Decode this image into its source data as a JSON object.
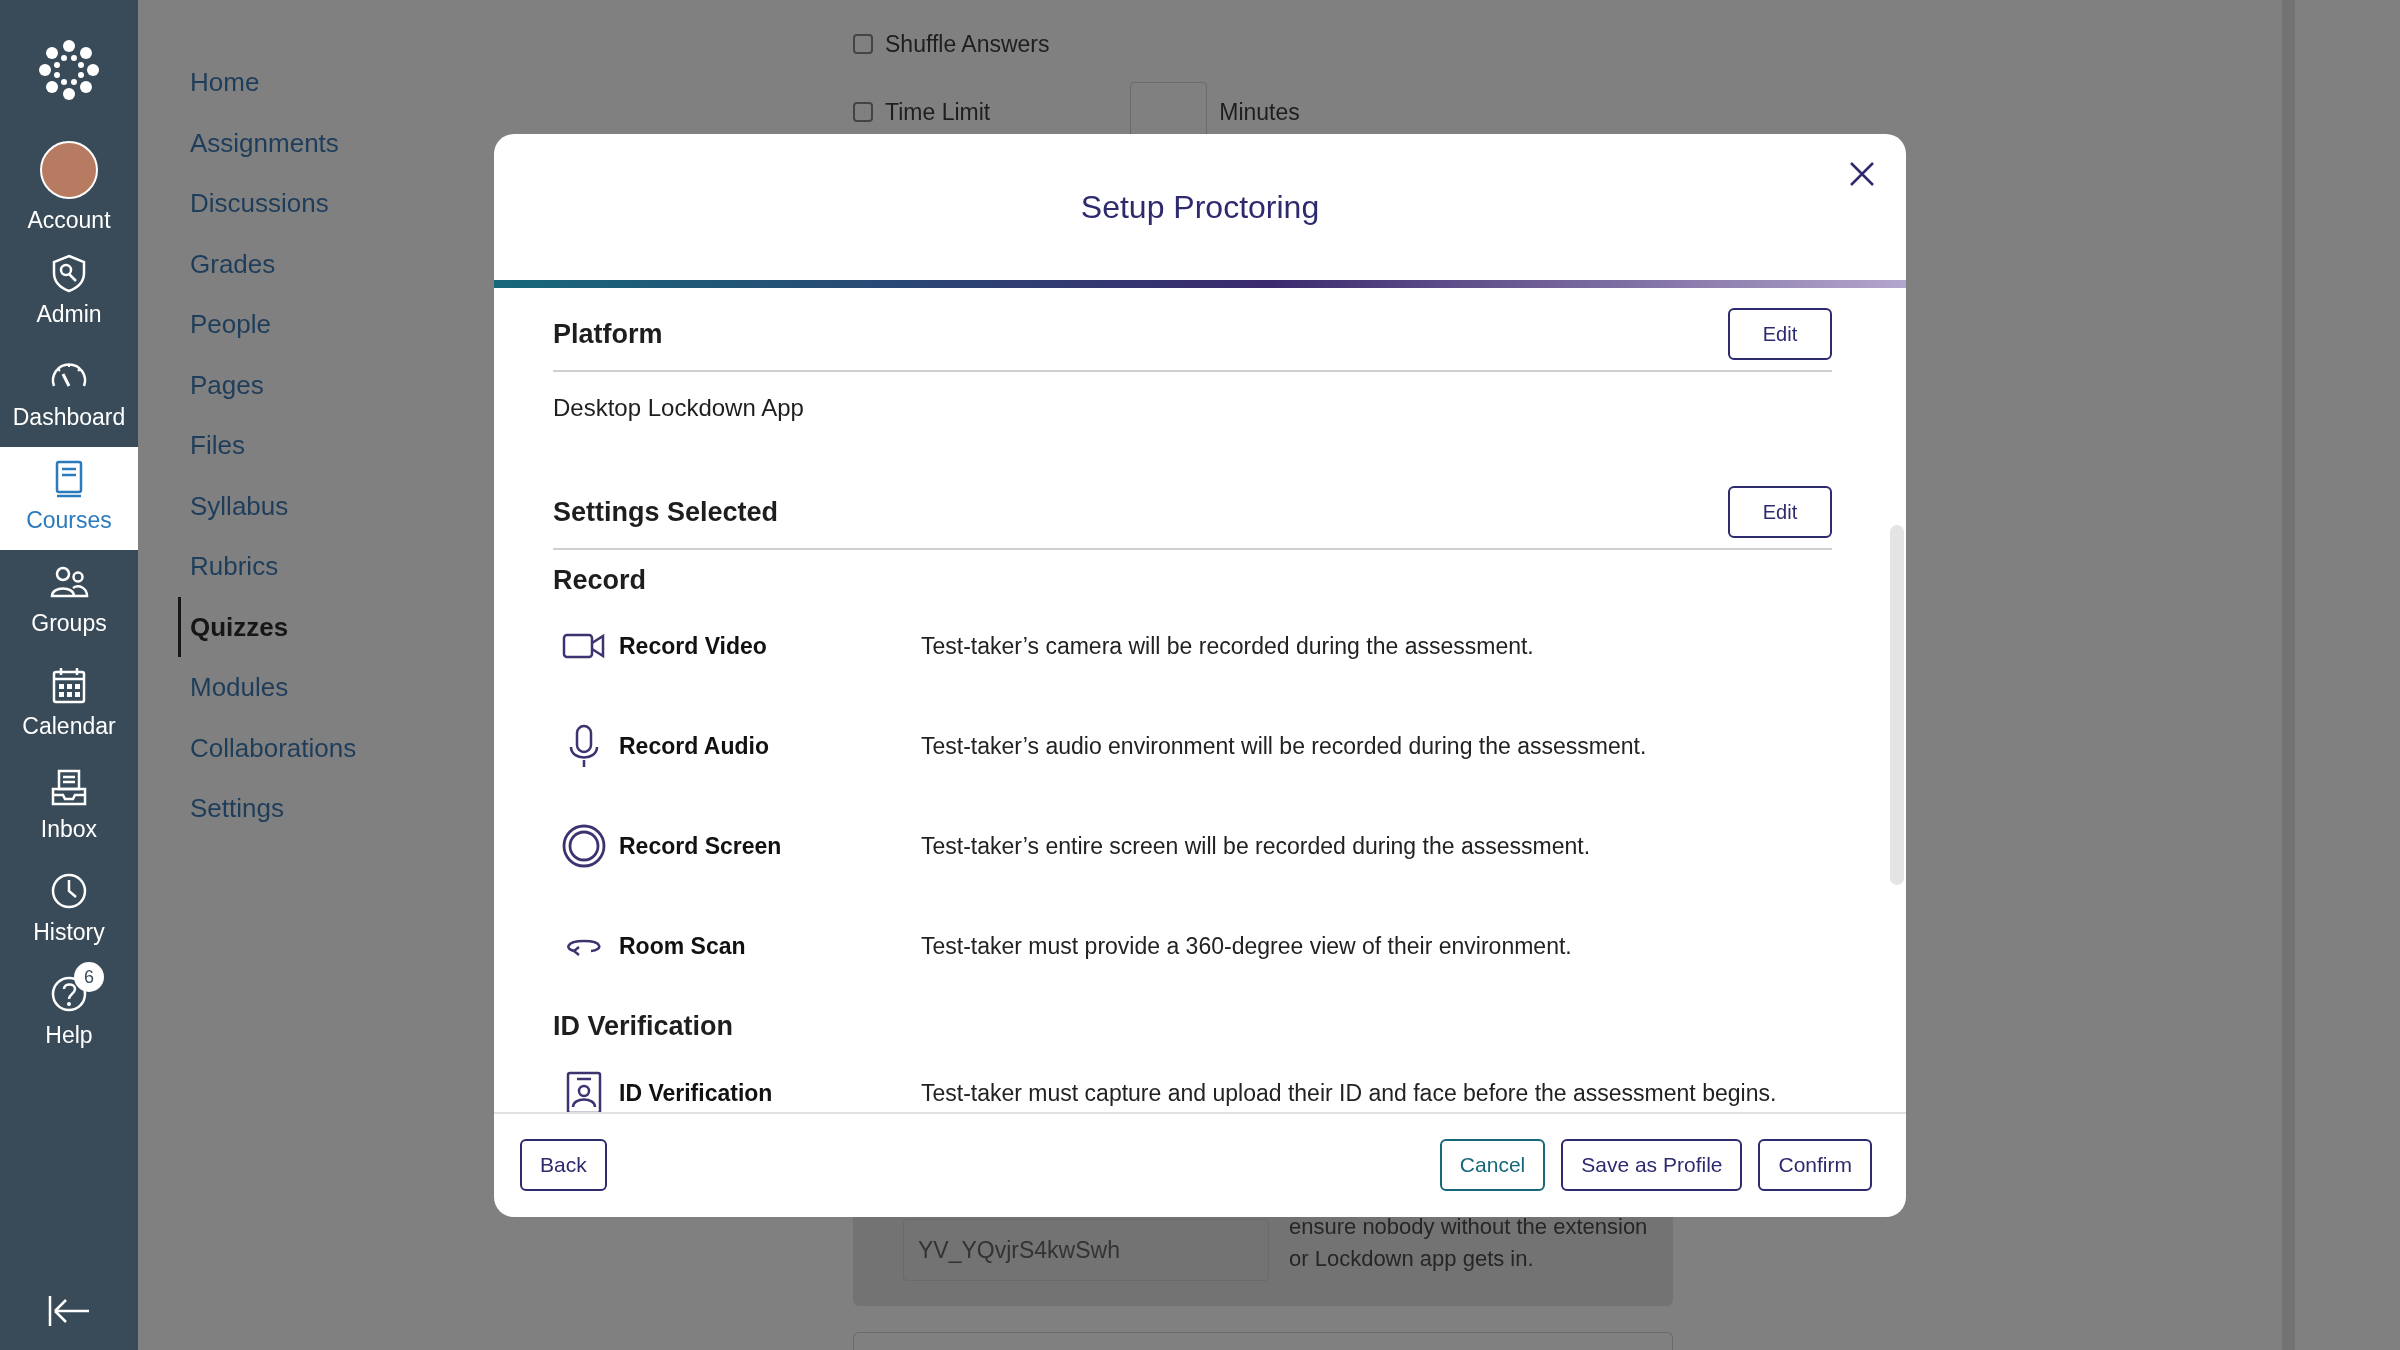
{
  "global_nav": {
    "items": [
      {
        "kind": "account",
        "label": "Account",
        "selected": false
      },
      {
        "kind": "admin",
        "label": "Admin",
        "selected": false
      },
      {
        "kind": "dashboard",
        "label": "Dashboard",
        "selected": false
      },
      {
        "kind": "courses",
        "label": "Courses",
        "selected": true
      },
      {
        "kind": "groups",
        "label": "Groups",
        "selected": false
      },
      {
        "kind": "calendar",
        "label": "Calendar",
        "selected": false
      },
      {
        "kind": "inbox",
        "label": "Inbox",
        "selected": false
      },
      {
        "kind": "history",
        "label": "History",
        "selected": false
      },
      {
        "kind": "help",
        "label": "Help",
        "selected": false,
        "badge": "6"
      }
    ]
  },
  "course_nav": {
    "items": [
      {
        "label": "Home",
        "selected": false
      },
      {
        "label": "Assignments",
        "selected": false
      },
      {
        "label": "Discussions",
        "selected": false
      },
      {
        "label": "Grades",
        "selected": false
      },
      {
        "label": "People",
        "selected": false
      },
      {
        "label": "Pages",
        "selected": false
      },
      {
        "label": "Files",
        "selected": false
      },
      {
        "label": "Syllabus",
        "selected": false
      },
      {
        "label": "Rubrics",
        "selected": false
      },
      {
        "label": "Quizzes",
        "selected": true
      },
      {
        "label": "Modules",
        "selected": false
      },
      {
        "label": "Collaborations",
        "selected": false
      },
      {
        "label": "Settings",
        "selected": false
      }
    ]
  },
  "quiz_options": {
    "checkboxes": [
      {
        "label": "Shuffle Answers",
        "checked": false
      },
      {
        "label": "Time Limit",
        "checked": false
      }
    ],
    "time_limit_unit": "Minutes"
  },
  "access_code": {
    "value": "YV_YQvjrS4kwSwh",
    "help_lines": [
      "ensure nobody without the extension",
      "or Lockdown app gets in."
    ]
  },
  "modal": {
    "title": "Setup Proctoring",
    "sections": [
      {
        "heading": "Platform",
        "edit_button": "Edit",
        "value": "Desktop Lockdown App"
      },
      {
        "heading": "Settings Selected",
        "edit_button": "Edit",
        "groups": [
          {
            "heading": "Record",
            "items": [
              {
                "kind": "video",
                "label": "Record Video",
                "description": "Test-taker’s camera will be recorded during the assessment."
              },
              {
                "kind": "audio",
                "label": "Record Audio",
                "description": "Test-taker’s audio environment will be recorded during the assessment."
              },
              {
                "kind": "screen",
                "label": "Record Screen",
                "description": "Test-taker’s entire screen will be recorded during the assessment."
              },
              {
                "kind": "room",
                "label": "Room Scan",
                "description": "Test-taker must provide a 360-degree view of their environment."
              }
            ]
          },
          {
            "heading": "ID Verification",
            "items": [
              {
                "kind": "id",
                "label": "ID Verification",
                "description": "Test-taker must capture and upload their ID and face before the assessment begins."
              }
            ]
          }
        ]
      }
    ],
    "back_button": "Back",
    "actions": [
      {
        "kind": "secondary",
        "label": "Cancel"
      },
      {
        "kind": "primary",
        "label": "Save as Profile"
      },
      {
        "kind": "primary",
        "label": "Confirm"
      }
    ]
  }
}
